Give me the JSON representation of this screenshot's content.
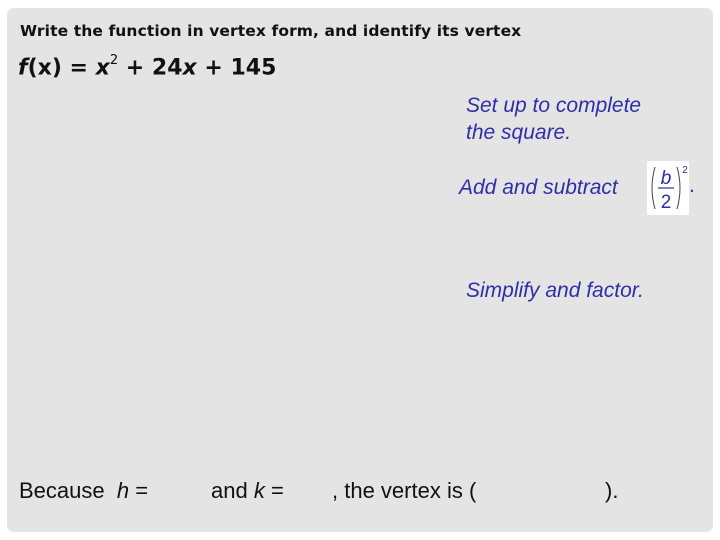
{
  "slide": {
    "title": "Write the function in vertex form, and identify its vertex",
    "equation": {
      "lhs_func": "f",
      "lhs_var": "(x)",
      "equals": " = ",
      "term1_var": "x",
      "term1_exp": "2",
      "term2": " + 24",
      "term2_var": "x",
      "term3": " + 145"
    },
    "steps": [
      {
        "line1": "Set up to complete",
        "line2": "the square."
      },
      {
        "text": "Add and subtract ",
        "fraction": {
          "numerator": "b",
          "denominator": "2",
          "exponent": "2"
        },
        "trailing": "."
      },
      {
        "text": "Simplify and factor."
      }
    ],
    "conclusion": {
      "part1": "Because  ",
      "h_var": "h",
      "h_eq": " =",
      "part2": "and ",
      "k_var": "k",
      "k_eq": " =",
      "part3": ", the vertex is (",
      "close": ")."
    }
  },
  "colors": {
    "panel_background": "#e4e4e4",
    "step_text": "#2e2ea8",
    "body_text": "#111111"
  }
}
